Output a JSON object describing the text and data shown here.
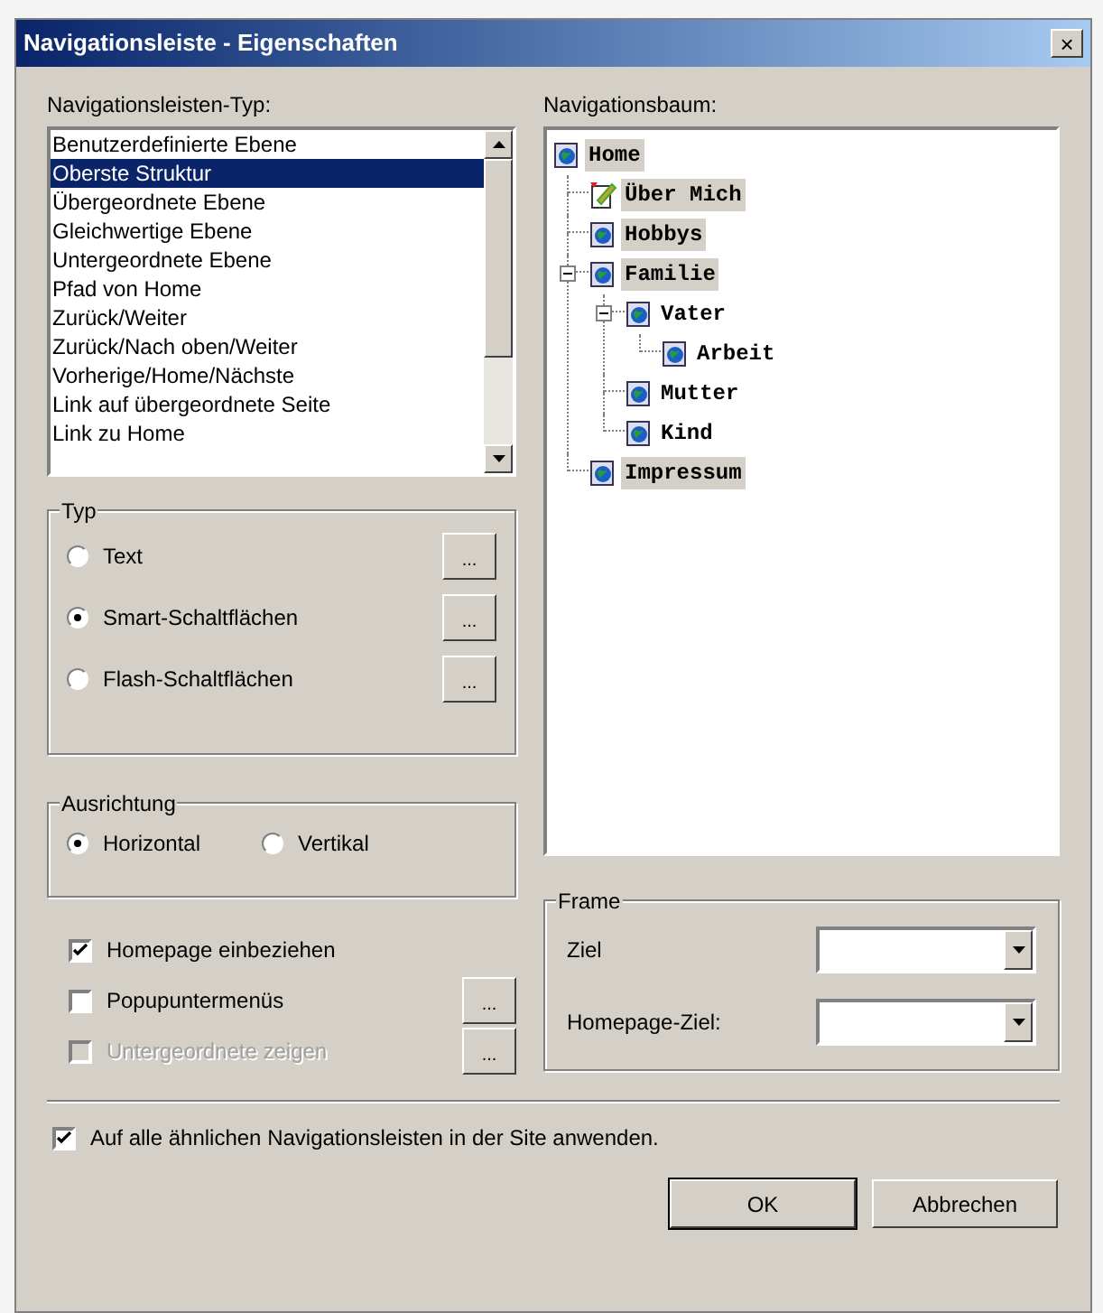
{
  "window": {
    "title": "Navigationsleiste - Eigenschaften",
    "close": "×"
  },
  "type_list": {
    "label": "Navigationsleisten-Typ:",
    "items": [
      {
        "label": "Benutzerdefinierte Ebene",
        "selected": false
      },
      {
        "label": "Oberste Struktur",
        "selected": true
      },
      {
        "label": "Übergeordnete Ebene",
        "selected": false
      },
      {
        "label": "Gleichwertige Ebene",
        "selected": false
      },
      {
        "label": "Untergeordnete Ebene",
        "selected": false
      },
      {
        "label": "Pfad von Home",
        "selected": false
      },
      {
        "label": "Zurück/Weiter",
        "selected": false
      },
      {
        "label": "Zurück/Nach oben/Weiter",
        "selected": false
      },
      {
        "label": "Vorherige/Home/Nächste",
        "selected": false
      },
      {
        "label": "Link auf übergeordnete Seite",
        "selected": false
      },
      {
        "label": "Link zu Home",
        "selected": false
      }
    ]
  },
  "typ_group": {
    "title": "Typ",
    "options": [
      {
        "label": "Text",
        "selected": false,
        "button": "..."
      },
      {
        "label": "Smart-Schaltflächen",
        "selected": true,
        "button": "..."
      },
      {
        "label": "Flash-Schaltflächen",
        "selected": false,
        "button": "..."
      }
    ]
  },
  "orientation_group": {
    "title": "Ausrichtung",
    "options": [
      {
        "label": "Horizontal",
        "selected": true
      },
      {
        "label": "Vertikal",
        "selected": false
      }
    ]
  },
  "options": [
    {
      "label": "Homepage einbeziehen",
      "checked": true,
      "disabled": false
    },
    {
      "label": "Popupuntermenüs",
      "checked": false,
      "disabled": false,
      "button": "..."
    },
    {
      "label": "Untergeordnete zeigen",
      "checked": false,
      "disabled": true,
      "button": "..."
    }
  ],
  "tree": {
    "label": "Navigationsbaum:",
    "root": {
      "label": "Home",
      "kind": "page",
      "highlighted": true,
      "children": [
        {
          "label": "Über Mich",
          "kind": "edit",
          "highlighted": true
        },
        {
          "label": "Hobbys",
          "kind": "page",
          "highlighted": true
        },
        {
          "label": "Familie",
          "kind": "page",
          "highlighted": true,
          "expanded": true,
          "children": [
            {
              "label": "Vater",
              "kind": "page",
              "highlighted": false,
              "expanded": true,
              "children": [
                {
                  "label": "Arbeit",
                  "kind": "page",
                  "highlighted": false
                }
              ]
            },
            {
              "label": "Mutter",
              "kind": "page",
              "highlighted": false
            },
            {
              "label": "Kind",
              "kind": "page",
              "highlighted": false
            }
          ]
        },
        {
          "label": "Impressum",
          "kind": "page",
          "highlighted": true
        }
      ]
    }
  },
  "frame_group": {
    "title": "Frame",
    "fields": [
      {
        "label": "Ziel"
      },
      {
        "label": "Homepage-Ziel:"
      }
    ]
  },
  "apply_all": {
    "label": "Auf alle ähnlichen Navigationsleisten in der Site anwenden.",
    "checked": true
  },
  "buttons": [
    {
      "label": "OK",
      "default": true
    },
    {
      "label": "Abbrechen",
      "default": false
    }
  ]
}
